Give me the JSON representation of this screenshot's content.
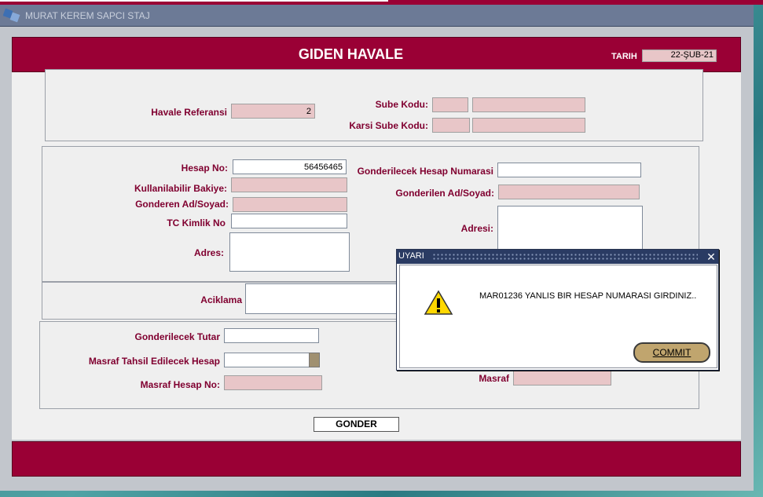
{
  "window": {
    "title": "MURAT KEREM SAPCI STAJ"
  },
  "header": {
    "title": "GIDEN HAVALE",
    "date_label": "TARIH",
    "date_value": "22-ŞUB-21"
  },
  "top_section": {
    "havale_referansi_label": "Havale Referansi",
    "havale_referansi_value": "2",
    "sube_kodu_label": "Sube Kodu:",
    "sube_kodu_value": "",
    "sube_kodu_desc": "",
    "karsi_sube_kodu_label": "Karsi Sube Kodu:",
    "karsi_sube_kodu_value": "",
    "karsi_sube_kodu_desc": ""
  },
  "sender": {
    "hesap_no_label": "Hesap No:",
    "hesap_no_value": "56456465",
    "kullanilabilir_bakiye_label": "Kullanilabilir Bakiye:",
    "kullanilabilir_bakiye_value": "",
    "gonderen_ad_label": "Gonderen Ad/Soyad:",
    "gonderen_ad_value": "",
    "tc_kimlik_label": "TC Kimlik No",
    "tc_kimlik_value": "",
    "adres_label": "Adres:",
    "adres_value": ""
  },
  "receiver": {
    "hesap_label": "Gonderilecek Hesap Numarasi",
    "hesap_value": "",
    "ad_label": "Gonderilen Ad/Soyad:",
    "ad_value": "",
    "adres_label": "Adresi:",
    "adres_value": ""
  },
  "aciklama": {
    "label": "Aciklama",
    "value": ""
  },
  "amount": {
    "tutar_label": "Gonderilecek Tutar",
    "tutar_value": "",
    "masraf_tahsil_label": "Masraf Tahsil Edilecek Hesap",
    "masraf_tahsil_value": "",
    "masraf_hesap_label": "Masraf Hesap No:",
    "masraf_hesap_value": "",
    "masraf_label": "Masraf",
    "masraf_value": ""
  },
  "buttons": {
    "gonder": "GONDER"
  },
  "dialog": {
    "title": "UYARI",
    "close": "✕",
    "message": "MAR01236 YANLIS BIR HESAP NUMARASI GIRDINIZ..",
    "icon": "warning-icon",
    "commit_label": "COMMIT"
  },
  "colors": {
    "brand": "#9a0035",
    "label": "#800030",
    "readonly_field": "#e8c6c8",
    "dialog_titlebar": "#2a3b63"
  }
}
